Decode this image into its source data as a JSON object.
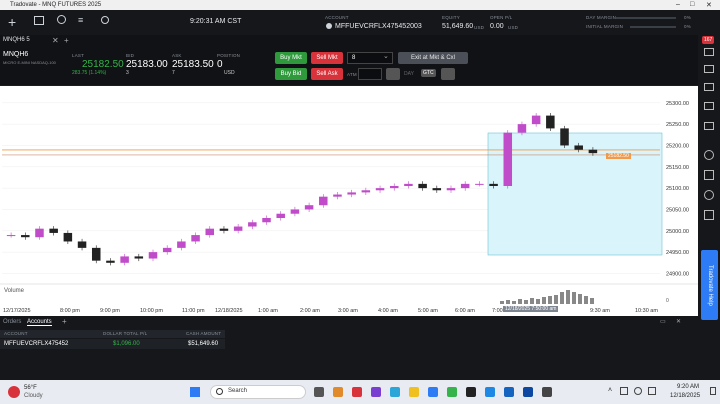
{
  "window": {
    "title": "Tradovate - MNQ FUTURES 2025"
  },
  "topbar": {
    "time": "9:20:31 AM CST",
    "account_label": "ACCOUNT",
    "account_value": "MFFUEVCRFLX475452003",
    "equity_label": "EQUITY",
    "equity_value": "51,649.60",
    "equity_unit": "USD",
    "openpl_label": "OPEN P/L",
    "openpl_value": "0.00",
    "openpl_unit": "USD",
    "day_margin_label": "DAY MARGIN",
    "day_margin_pct": "0%",
    "initial_margin_label": "INITIAL MARGIN",
    "initial_margin_pct": "0%",
    "notif_count": "167"
  },
  "quote": {
    "symbol": "MNQH6",
    "symbol_desc": "MICRO E-MINI NASDAQ-100",
    "tab_label": "MNQH6 5",
    "last_label": "LAST",
    "last": "25182.50",
    "change": "283.75 (1.14%)",
    "bid_label": "BID",
    "bid": "25183.00",
    "bid_size": "3",
    "ask_label": "ASK",
    "ask": "25183.50",
    "ask_size": "7",
    "position_label": "POSITION",
    "position": "0",
    "position_unit": "USD",
    "buy_mkt": "Buy Mkt",
    "sell_mkt": "Sell Mkt",
    "buy_bid": "Buy Bid",
    "sell_ask": "Sell Ask",
    "qty": "8",
    "exit_label": "Exit at Mkt & Cxl",
    "tif_day": "DAY",
    "tif_gtc": "GTC",
    "atm_label": "ATM"
  },
  "chart_data": {
    "type": "candlestick",
    "price_label": "25182.50",
    "volume_label": "Volume",
    "volume_zero": "0",
    "crosshair_label": "12/18/2025 7:50:00 am",
    "y_ticks": [
      "25300.00",
      "25250.00",
      "25200.00",
      "25150.00",
      "25100.00",
      "25050.00",
      "25000.00",
      "24950.00",
      "24900.00"
    ],
    "x_ticks": [
      "12/17/2025",
      "8:00 pm",
      "9:00 pm",
      "10:00 pm",
      "11:00 pm",
      "12/18/2025",
      "1:00 am",
      "2:00 am",
      "3:00 am",
      "4:00 am",
      "5:00 am",
      "6:00 am",
      "7:00 am",
      "9:30 am",
      "10:30 am"
    ],
    "ylim": [
      24880,
      25330
    ],
    "series_close": [
      24990,
      24985,
      25005,
      24995,
      24975,
      24960,
      24930,
      24925,
      24940,
      24935,
      24950,
      24960,
      24975,
      24990,
      25005,
      25000,
      25010,
      25020,
      25030,
      25040,
      25050,
      25060,
      25080,
      25085,
      25090,
      25095,
      25100,
      25105,
      25110,
      25100,
      25095,
      25100,
      25110,
      25110,
      25105,
      25230,
      25250,
      25270,
      25240,
      25200,
      25190,
      25182
    ]
  },
  "bottom": {
    "tab_orders": "Orders",
    "tab_accounts": "Accounts",
    "col_account": "ACCOUNT",
    "col_pl": "DOLLAR TOTAL P/L",
    "col_cash": "CASH AMOUNT",
    "row_account": "MFFUEVCRFLX475452",
    "row_pl": "$1,096.00",
    "row_cash": "$51,649.60"
  },
  "taskbar": {
    "weather_temp": "56°F",
    "weather_desc": "Cloudy",
    "search_placeholder": "Search",
    "clock_time": "9:20 AM",
    "clock_date": "12/18/2025"
  },
  "help_tab": "Tradovate Help",
  "colors": {
    "accent_green": "#2e9a3c",
    "accent_red": "#d8333b",
    "candle_up": "#c04cc9",
    "candle_down": "#222222",
    "last_price_line": "#f09a4a"
  }
}
